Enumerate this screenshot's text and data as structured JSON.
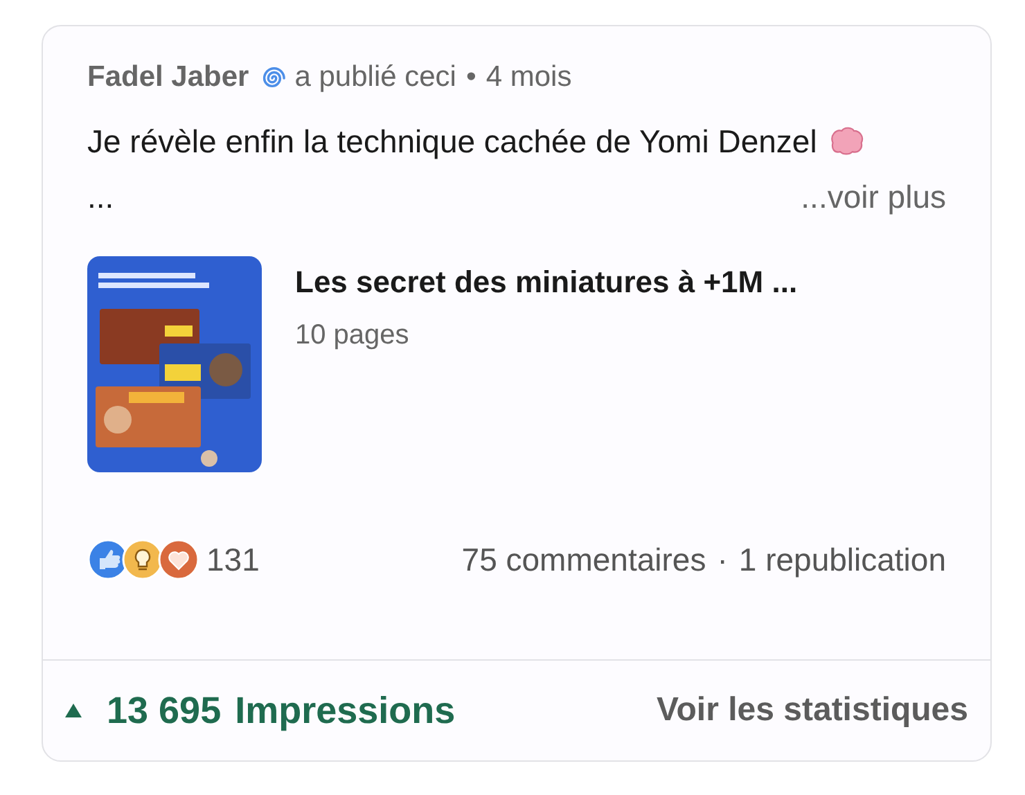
{
  "header": {
    "author": "Fadel Jaber",
    "action": "a publié ceci",
    "separator": "•",
    "time": "4 mois"
  },
  "post": {
    "text": "Je révèle enfin la technique cachée de Yomi Denzel",
    "ellipsis": "...",
    "see_more": "...voir plus"
  },
  "document": {
    "kind": "picture",
    "title": "Les secret des miniatures à +1M ...",
    "pages": "10 pages"
  },
  "social": {
    "reactions_count": "131",
    "comments": "75 commentaires",
    "separator": "·",
    "reposts": "1 republication"
  },
  "footer": {
    "impressions_count": "13 695",
    "impressions_label": "Impressions",
    "stats_link": "Voir les statistiques"
  }
}
